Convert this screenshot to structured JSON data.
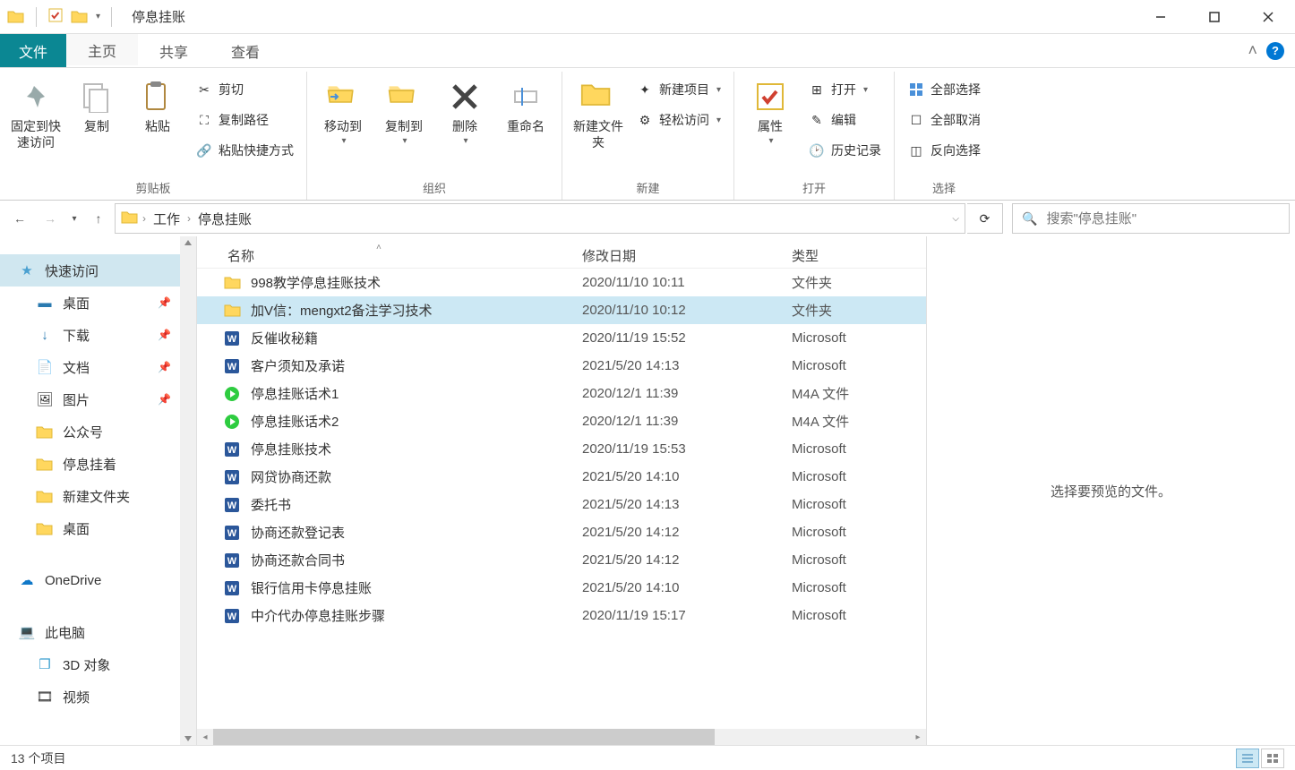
{
  "window": {
    "title": "停息挂账"
  },
  "tabs": {
    "file": "文件",
    "home": "主页",
    "share": "共享",
    "view": "查看"
  },
  "ribbon": {
    "clipboard": {
      "label": "剪贴板",
      "pin": "固定到快速访问",
      "copy": "复制",
      "paste": "粘贴",
      "cut": "剪切",
      "copypath": "复制路径",
      "pasteshortcut": "粘贴快捷方式"
    },
    "organize": {
      "label": "组织",
      "moveto": "移动到",
      "copyto": "复制到",
      "delete": "删除",
      "rename": "重命名"
    },
    "new": {
      "label": "新建",
      "newfolder": "新建文件夹",
      "newitem": "新建项目",
      "easyaccess": "轻松访问"
    },
    "open": {
      "label": "打开",
      "properties": "属性",
      "open": "打开",
      "edit": "编辑",
      "history": "历史记录"
    },
    "select": {
      "label": "选择",
      "selectall": "全部选择",
      "selectnone": "全部取消",
      "invert": "反向选择"
    }
  },
  "breadcrumbs": {
    "p1": "工作",
    "p2": "停息挂账"
  },
  "search": {
    "placeholder": "搜索\"停息挂账\""
  },
  "sidebar": {
    "quick": "快速访问",
    "desktop": "桌面",
    "downloads": "下载",
    "documents": "文档",
    "pictures": "图片",
    "f1": "公众号",
    "f2": "停息挂着",
    "f3": "新建文件夹",
    "f4": "桌面",
    "onedrive": "OneDrive",
    "thispc": "此电脑",
    "obj3d": "3D 对象",
    "videos": "视频"
  },
  "columns": {
    "name": "名称",
    "date": "修改日期",
    "type": "类型"
  },
  "files": [
    {
      "icon": "folder",
      "name": "998教学停息挂账技术",
      "date": "2020/11/10 10:11",
      "type": "文件夹"
    },
    {
      "icon": "folder",
      "name": "加V信：mengxt2备注学习技术",
      "date": "2020/11/10 10:12",
      "type": "文件夹",
      "selected": true
    },
    {
      "icon": "word",
      "name": "反催收秘籍",
      "date": "2020/11/19 15:52",
      "type": "Microsoft"
    },
    {
      "icon": "word",
      "name": "客户须知及承诺",
      "date": "2021/5/20 14:13",
      "type": "Microsoft"
    },
    {
      "icon": "audio",
      "name": "停息挂账话术1",
      "date": "2020/12/1 11:39",
      "type": "M4A 文件"
    },
    {
      "icon": "audio",
      "name": "停息挂账话术2",
      "date": "2020/12/1 11:39",
      "type": "M4A 文件"
    },
    {
      "icon": "word",
      "name": "停息挂账技术",
      "date": "2020/11/19 15:53",
      "type": "Microsoft"
    },
    {
      "icon": "word",
      "name": "网贷协商还款",
      "date": "2021/5/20 14:10",
      "type": "Microsoft"
    },
    {
      "icon": "word",
      "name": "委托书",
      "date": "2021/5/20 14:13",
      "type": "Microsoft"
    },
    {
      "icon": "word",
      "name": "协商还款登记表",
      "date": "2021/5/20 14:12",
      "type": "Microsoft"
    },
    {
      "icon": "word",
      "name": "协商还款合同书",
      "date": "2021/5/20 14:12",
      "type": "Microsoft"
    },
    {
      "icon": "word",
      "name": "银行信用卡停息挂账",
      "date": "2021/5/20 14:10",
      "type": "Microsoft"
    },
    {
      "icon": "word",
      "name": "中介代办停息挂账步骤",
      "date": "2020/11/19 15:17",
      "type": "Microsoft"
    }
  ],
  "preview": {
    "empty": "选择要预览的文件。"
  },
  "status": {
    "count": "13 个项目"
  }
}
